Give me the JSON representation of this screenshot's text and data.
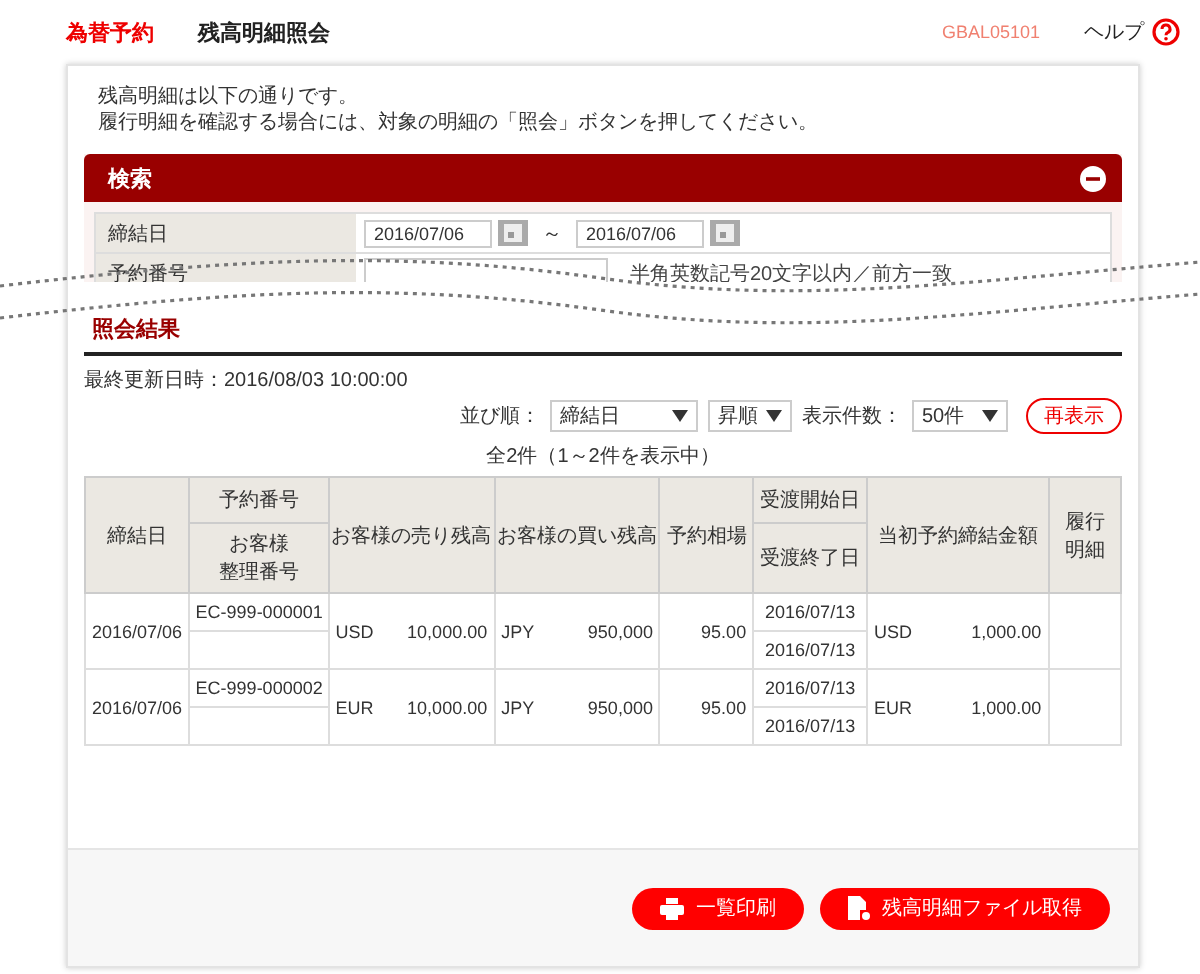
{
  "header": {
    "category": "為替予約",
    "title": "残高明細照会",
    "screen_id": "GBAL05101",
    "help": "ヘルプ"
  },
  "intro": [
    "残高明細は以下の通りです。",
    "履行明細を確認する場合には、対象の明細の「照会」ボタンを押してください。"
  ],
  "search": {
    "title": "検索",
    "expanded": true,
    "fields": [
      {
        "label": "締結日",
        "kind": "date_range",
        "from": "2016/07/06",
        "separator": "～",
        "to": "2016/07/06"
      },
      {
        "label": "予約番号",
        "kind": "text",
        "hint": "半角英数記号20文字以内／前方一致"
      }
    ]
  },
  "results": {
    "title": "照会結果",
    "last_updated": "最終更新日時：2016/08/03 10:00:00",
    "sort_label": "並び順：",
    "sort_field": "締結日",
    "sort_order": "昇順",
    "count_label": "表示件数：",
    "count": "50件",
    "refresh": "再表示",
    "summary": "全2件（1～2件を表示中）"
  },
  "table": {
    "columns": {
      "date": "締結日",
      "order_no": "予約番号",
      "ref_no": [
        "お客様",
        "整理番号"
      ],
      "sell": "お客様の売り残高",
      "buy": "お客様の買い残高",
      "rate": "予約相場",
      "start": "受渡開始日",
      "end": "受渡終了日",
      "initial": "当初予約締結金額",
      "detail": [
        "履行",
        "明細"
      ]
    },
    "rows": [
      {
        "date": "2016/07/06",
        "order_no": "EC-999-000001",
        "sell_ccy": "USD",
        "sell_amount": "10,000.00",
        "buy_ccy": "JPY",
        "buy_amount": "950,000",
        "rate": "95.00",
        "start": "2016/07/13",
        "end": "2016/07/13",
        "initial_ccy": "USD",
        "initial_amount": "1,000.00"
      },
      {
        "date": "2016/07/06",
        "order_no": "EC-999-000002",
        "sell_ccy": "EUR",
        "sell_amount": "10,000.00",
        "buy_ccy": "JPY",
        "buy_amount": "950,000",
        "rate": "95.00",
        "start": "2016/07/13",
        "end": "2016/07/13",
        "initial_ccy": "EUR",
        "initial_amount": "1,000.00"
      }
    ]
  },
  "buttons": [
    {
      "label": "一覧印刷",
      "kind": "print"
    },
    {
      "label": "残高明細ファイル取得",
      "kind": "file"
    }
  ]
}
